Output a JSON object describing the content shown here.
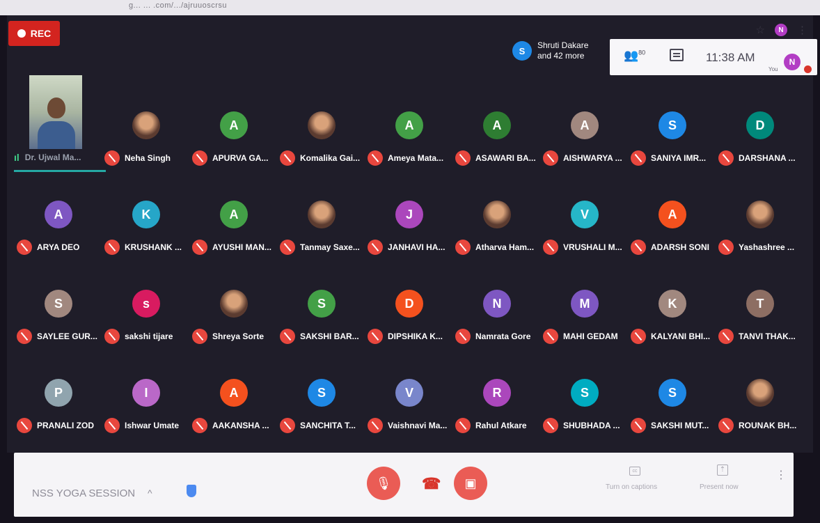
{
  "browser": {
    "url": "g... ... .com/.../ajruuoscrsu",
    "star_icon": "☆",
    "profile_initial": "N",
    "menu_icon": "⋮"
  },
  "meeting": {
    "rec_label": "REC",
    "presenter_initial": "S",
    "presenter_line1": "Shruti Dakare",
    "presenter_line2": "and 42 more",
    "people_count": "80",
    "time": "11:38 AM",
    "you_label": "You",
    "me_initial": "N",
    "self_name": "Dr. Ujwal Ma...",
    "meeting_name": "NSS YOGA SESSION",
    "captions_label": "Turn on captions",
    "present_label": "Present now"
  },
  "participants": [
    {
      "name": "Neha Singh",
      "initial": "",
      "photo": true,
      "color": ""
    },
    {
      "name": "APURVA GA...",
      "initial": "A",
      "color": "#43a047"
    },
    {
      "name": "Komalika Gai...",
      "initial": "",
      "photo": true,
      "color": ""
    },
    {
      "name": "Ameya Mata...",
      "initial": "A",
      "color": "#43a047"
    },
    {
      "name": "ASAWARI BA...",
      "initial": "A",
      "color": "#2e7d32"
    },
    {
      "name": "AISHWARYA ...",
      "initial": "A",
      "color": "#a1887f"
    },
    {
      "name": "SANIYA IMR...",
      "initial": "S",
      "color": "#1e88e5"
    },
    {
      "name": "DARSHANA ...",
      "initial": "D",
      "color": "#00897b"
    },
    {
      "name": "ARYA DEO",
      "initial": "A",
      "color": "#7e57c2"
    },
    {
      "name": "KRUSHANK ...",
      "initial": "K",
      "color": "#26a6c8"
    },
    {
      "name": "AYUSHI MAN...",
      "initial": "A",
      "color": "#43a047"
    },
    {
      "name": "Tanmay Saxe...",
      "initial": "",
      "photo": true,
      "color": ""
    },
    {
      "name": "JANHAVI HA...",
      "initial": "J",
      "color": "#ab47bc"
    },
    {
      "name": "Atharva Ham...",
      "initial": "",
      "photo": true,
      "color": ""
    },
    {
      "name": "VRUSHALI M...",
      "initial": "V",
      "color": "#26b6c8"
    },
    {
      "name": "ADARSH SONI",
      "initial": "A",
      "color": "#f4511e"
    },
    {
      "name": "Yashashree ...",
      "initial": "",
      "photo": true,
      "color": ""
    },
    {
      "name": "SAYLEE GUR...",
      "initial": "S",
      "color": "#a1887f"
    },
    {
      "name": "sakshi tijare",
      "initial": "s",
      "color": "#d81b60"
    },
    {
      "name": "Shreya Sorte",
      "initial": "",
      "photo": true,
      "color": ""
    },
    {
      "name": "SAKSHI BAR...",
      "initial": "S",
      "color": "#43a047"
    },
    {
      "name": "DIPSHIKA K...",
      "initial": "D",
      "color": "#f4511e"
    },
    {
      "name": "Namrata Gore",
      "initial": "N",
      "color": "#7e57c2"
    },
    {
      "name": "MAHI GEDAM",
      "initial": "M",
      "color": "#7e57c2"
    },
    {
      "name": "KALYANI BHI...",
      "initial": "K",
      "color": "#a1887f"
    },
    {
      "name": "TANVI THAK...",
      "initial": "T",
      "color": "#8d6e63"
    },
    {
      "name": "PRANALI ZOD",
      "initial": "P",
      "color": "#90a4ae"
    },
    {
      "name": "Ishwar Umate",
      "initial": "I",
      "color": "#ba68c8"
    },
    {
      "name": "AAKANSHA ...",
      "initial": "A",
      "color": "#f4511e"
    },
    {
      "name": "SANCHITA T...",
      "initial": "S",
      "color": "#1e88e5"
    },
    {
      "name": "Vaishnavi Ma...",
      "initial": "V",
      "color": "#7986cb"
    },
    {
      "name": "Rahul Atkare",
      "initial": "R",
      "color": "#ab47bc"
    },
    {
      "name": "SHUBHADA ...",
      "initial": "S",
      "color": "#00acc1"
    },
    {
      "name": "SAKSHI MUT...",
      "initial": "S",
      "color": "#1e88e5"
    },
    {
      "name": "ROUNAK BH...",
      "initial": "",
      "photo": true,
      "color": ""
    }
  ]
}
